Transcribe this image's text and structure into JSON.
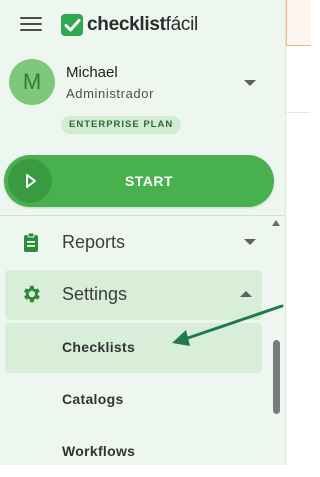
{
  "app": {
    "logo_text_bold": "checklist",
    "logo_text_light": "fácil"
  },
  "user": {
    "initial": "M",
    "name": "Michael",
    "role": "Administrador",
    "plan": "ENTERPRISE PLAN"
  },
  "start_button": {
    "label": "START"
  },
  "nav": {
    "reports": {
      "label": "Reports",
      "expanded": false
    },
    "settings": {
      "label": "Settings",
      "expanded": true,
      "children": [
        {
          "label": "Checklists",
          "selected": true
        },
        {
          "label": "Catalogs",
          "selected": false
        },
        {
          "label": "Workflows",
          "selected": false
        }
      ]
    }
  },
  "icons": {
    "menu": "hamburger-icon",
    "logo": "checkmark-logo-icon",
    "play": "play-icon",
    "reports": "clipboard-icon",
    "settings": "gear-icon",
    "annotation": "arrow-annotation"
  },
  "colors": {
    "brand_green": "#48b04c",
    "brand_green_dark": "#2e7d32",
    "sidebar_bg": "#eef7ef",
    "selected_bg": "#d8eed9",
    "annotation_arrow": "#1f7a4d"
  }
}
